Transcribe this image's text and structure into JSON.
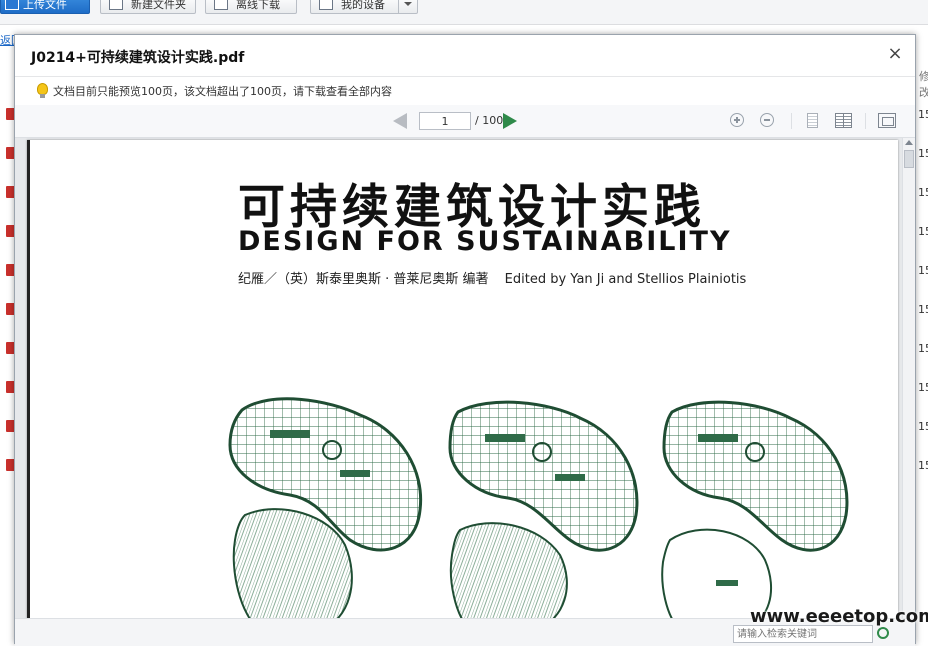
{
  "toolbar": {
    "upload_label": "上传文件",
    "new_folder_label": "新建文件夹",
    "offline_label": "离线下载",
    "device_label": "我的设备"
  },
  "breadcrumb": {
    "text": "返回上一级"
  },
  "list": {
    "right_header": "修改",
    "right_value": "15"
  },
  "dialog": {
    "title": "J0214+可持续建筑设计实践.pdf",
    "close_symbol": "×",
    "notice": "文档目前只能预览100页，该文档超出了100页，请下载查看全部内容"
  },
  "viewer": {
    "current_page": "1",
    "total_pages": "/ 100"
  },
  "page_content": {
    "cn_title": "可持续建筑设计实践",
    "en_title": "DESIGN FOR SUSTAINABILITY",
    "authors_cn": "纪雁／（英）斯泰里奥斯 · 普莱尼奥斯  编著",
    "authors_en": "Edited by Yan Ji and Stellios Plainiotis"
  },
  "footer": {
    "search_placeholder": "请输入检索关键词"
  },
  "watermark": "www.eeeetop.com",
  "colors": {
    "accent_green": "#2f8a4a",
    "upload_blue": "#1e6cc7",
    "file_red": "#c9302c"
  }
}
